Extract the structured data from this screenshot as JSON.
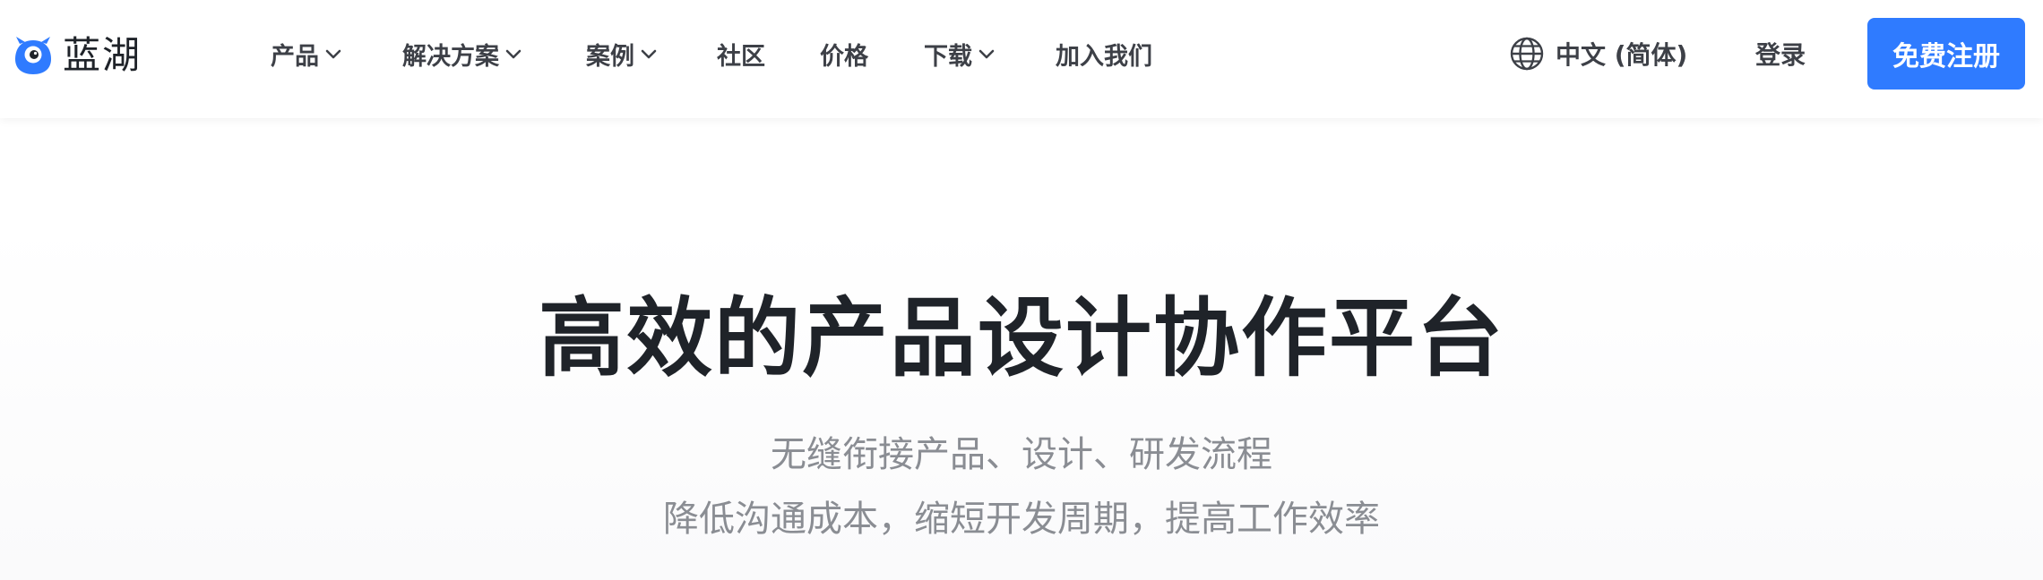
{
  "brand": {
    "name": "蓝湖",
    "accent_color": "#2f7bff",
    "icon": "lanhu-mascot-icon"
  },
  "nav": {
    "items": [
      {
        "label": "产品",
        "has_dropdown": true
      },
      {
        "label": "解决方案",
        "has_dropdown": true
      },
      {
        "label": "案例",
        "has_dropdown": true
      },
      {
        "label": "社区",
        "has_dropdown": false
      },
      {
        "label": "价格",
        "has_dropdown": false
      },
      {
        "label": "下载",
        "has_dropdown": true
      },
      {
        "label": "加入我们",
        "has_dropdown": false
      }
    ]
  },
  "header_right": {
    "language": "中文 (简体)",
    "language_icon": "globe-icon",
    "login_label": "登录",
    "signup_label": "免费注册"
  },
  "hero": {
    "title": "高效的产品设计协作平台",
    "subtitle_line1": "无缝衔接产品、设计、研发流程",
    "subtitle_line2": "降低沟通成本，缩短开发周期，提高工作效率"
  }
}
